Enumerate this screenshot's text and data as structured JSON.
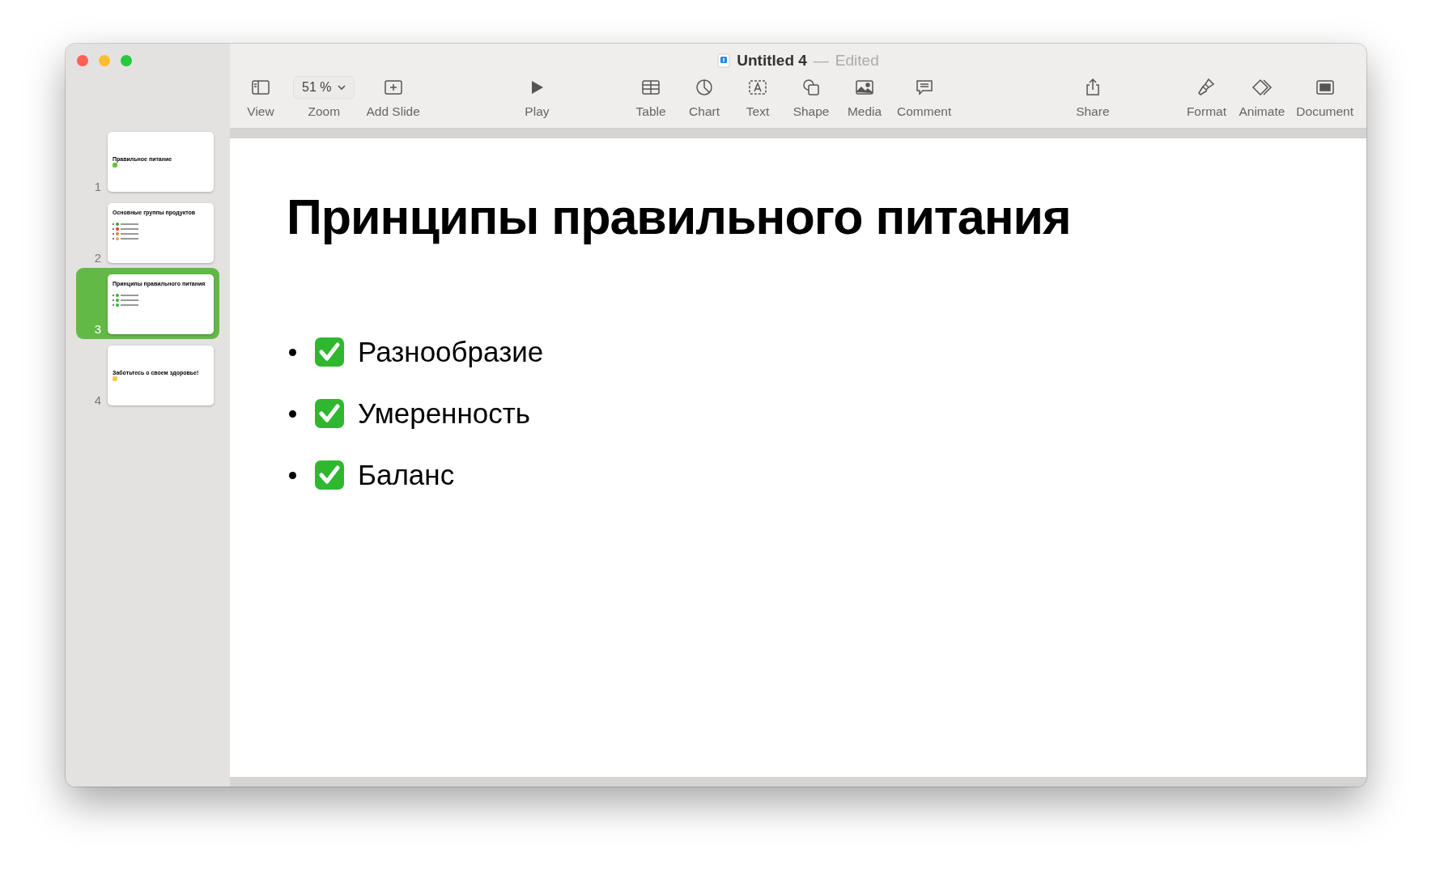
{
  "window": {
    "title": "Untitled 4",
    "separator": "—",
    "status": "Edited"
  },
  "toolbar": {
    "groups": [
      [
        {
          "kind": "view",
          "label": "View"
        },
        {
          "kind": "zoom",
          "label": "Zoom",
          "value": "51 %"
        },
        {
          "kind": "add",
          "label": "Add Slide"
        }
      ],
      [
        {
          "kind": "play",
          "label": "Play"
        }
      ],
      [
        {
          "kind": "table",
          "label": "Table"
        },
        {
          "kind": "chart",
          "label": "Chart"
        },
        {
          "kind": "text",
          "label": "Text"
        },
        {
          "kind": "shape",
          "label": "Shape"
        },
        {
          "kind": "media",
          "label": "Media"
        },
        {
          "kind": "comment",
          "label": "Comment"
        }
      ],
      [
        {
          "kind": "share",
          "label": "Share"
        }
      ],
      [
        {
          "kind": "format",
          "label": "Format"
        },
        {
          "kind": "animate",
          "label": "Animate"
        },
        {
          "kind": "document",
          "label": "Document"
        }
      ]
    ]
  },
  "slides": [
    {
      "number": "1",
      "selected": false,
      "kind": "title",
      "title": "Правильное питание"
    },
    {
      "number": "2",
      "selected": false,
      "kind": "list",
      "title": "Основные группы продуктов"
    },
    {
      "number": "3",
      "selected": true,
      "kind": "list",
      "title": "Принципы правильного питания"
    },
    {
      "number": "4",
      "selected": false,
      "kind": "title",
      "title": "Заботьтесь о своем здоровье!"
    }
  ],
  "canvas": {
    "title": "Принципы правильного питания",
    "bullets": [
      "Разнообразие",
      "Умеренность",
      "Баланс"
    ]
  }
}
